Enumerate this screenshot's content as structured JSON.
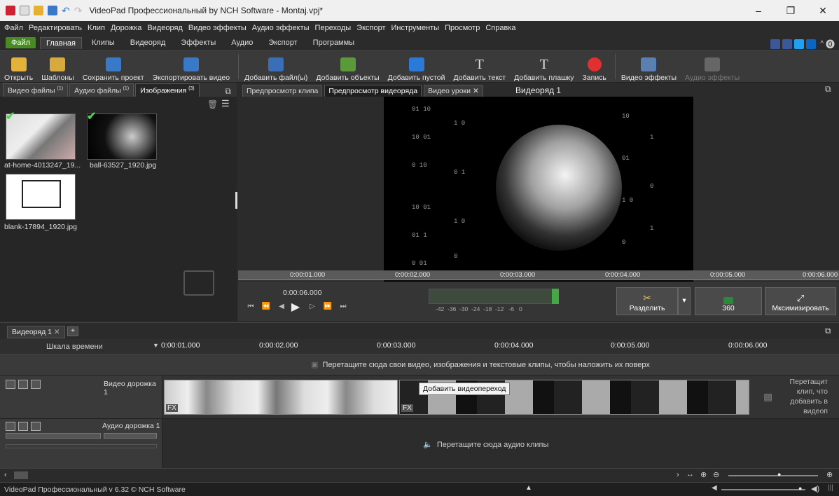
{
  "window": {
    "title": "VideoPad Профессиональный by NCH Software - Montaj.vpj*"
  },
  "menu": [
    "Файл",
    "Редактировать",
    "Клип",
    "Дорожка",
    "Видеоряд",
    "Видео эффекты",
    "Аудио эффекты",
    "Переходы",
    "Экспорт",
    "Инструменты",
    "Просмотр",
    "Справка"
  ],
  "ribbon_tabs": [
    "Файл",
    "Главная",
    "Клипы",
    "Видеоряд",
    "Эффекты",
    "Аудио",
    "Экспорт",
    "Программы"
  ],
  "ribbon_active": "Главная",
  "toolbar": {
    "open": "Открыть",
    "templates": "Шаблоны",
    "save": "Сохранить проект",
    "export": "Экспортировать видео",
    "add_files": "Добавить файл(ы)",
    "add_objects": "Добавить объекты",
    "add_blank": "Добавить пустой",
    "add_text": "Добавить текст",
    "add_plate": "Добавить плашку",
    "record": "Запись",
    "video_effects": "Видео эффекты",
    "audio_effects": "Аудио эффекты"
  },
  "media_panel": {
    "tabs": [
      "Видео файлы",
      "Аудио файлы",
      "Изображения"
    ],
    "tab_counts": [
      "(1)",
      "(1)",
      "(3)"
    ],
    "items": [
      {
        "label": "at-home-4013247_19...",
        "checked": true
      },
      {
        "label": "ball-63527_1920.jpg",
        "checked": true
      },
      {
        "label": "blank-17894_1920.jpg",
        "checked": false
      }
    ]
  },
  "preview": {
    "tabs": [
      "Предпросмотр клипа",
      "Предпросмотр видеоряда",
      "Видео уроки"
    ],
    "active_tab": "Предпросмотр видеоряда",
    "sequence_label": "Видеоряд 1",
    "ruler": [
      "0:00:01.000",
      "0:00:02.000",
      "0:00:03.000",
      "0:00:04.000",
      "0:00:05.000",
      "0:00:06.000"
    ],
    "current_time": "0:00:06.000",
    "meter_scale": "-42  -36  -30  -24  -18  -12   -6   0",
    "split": "Разделить",
    "vr": "360",
    "maximize": "Мксимизировать"
  },
  "timeline": {
    "seq_tab": "Видеоряд 1",
    "scale_label": "Шкала времени",
    "ruler": [
      "0:00:01.000",
      "0:00:02.000",
      "0:00:03.000",
      "0:00:04.000",
      "0:00:05.000",
      "0:00:06.000"
    ],
    "overlay_hint": "Перетащите сюда свои видео, изображения и текстовые клипы, чтобы наложить их поверх",
    "video_track": "Видео дорожка 1",
    "tooltip": "Добавить видеопереход",
    "right_hint": "Перетащит клип, что добавить в видеоп",
    "audio_track": "Аудио дорожка 1",
    "audio_hint": "Перетащите сюда аудио клипы",
    "fx": "FX"
  },
  "status": {
    "text": "VideoPad Профессиональный v 6.32 © NCH Software"
  },
  "colors": {
    "accent_green": "#4a8a25",
    "record_red": "#e03030",
    "blue": "#2a7ad8"
  }
}
